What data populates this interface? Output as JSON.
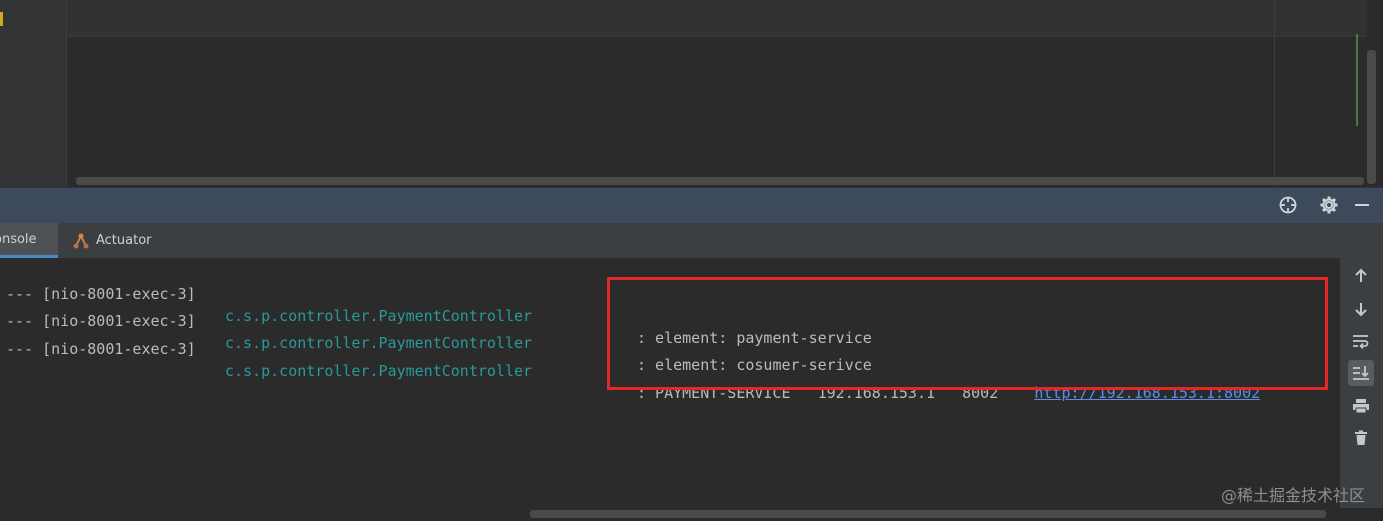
{
  "tabs": {
    "console_label": "onsole",
    "actuator_label": "Actuator"
  },
  "console": {
    "lines": [
      {
        "prefix": "--- [nio-8001-exec-3]",
        "logger": "c.s.p.controller.PaymentController",
        "message": ": element: payment-service",
        "url": ""
      },
      {
        "prefix": "--- [nio-8001-exec-3]",
        "logger": "c.s.p.controller.PaymentController",
        "message": ": element: cosumer-serivce",
        "url": ""
      },
      {
        "prefix": "--- [nio-8001-exec-3]",
        "logger": "c.s.p.controller.PaymentController",
        "message": ": PAYMENT-SERVICE   192.168.153.1   8002    ",
        "url": "http://192.168.153.1:8002"
      }
    ]
  },
  "icons": {
    "header": [
      "crosshair-icon",
      "gear-icon",
      "minimize-icon"
    ],
    "right_bar": [
      "arrow-up-icon",
      "arrow-down-icon",
      "soft-wrap-icon",
      "scroll-to-end-icon",
      "print-icon",
      "trash-icon"
    ],
    "tab": [
      "actuator-icon"
    ]
  },
  "colors": {
    "logger": "#299999",
    "highlight": "#e2282a",
    "link": "#5c8ee6",
    "tab_active_indicator": "#4a88c7"
  },
  "watermark": "@稀土掘金技术社区"
}
